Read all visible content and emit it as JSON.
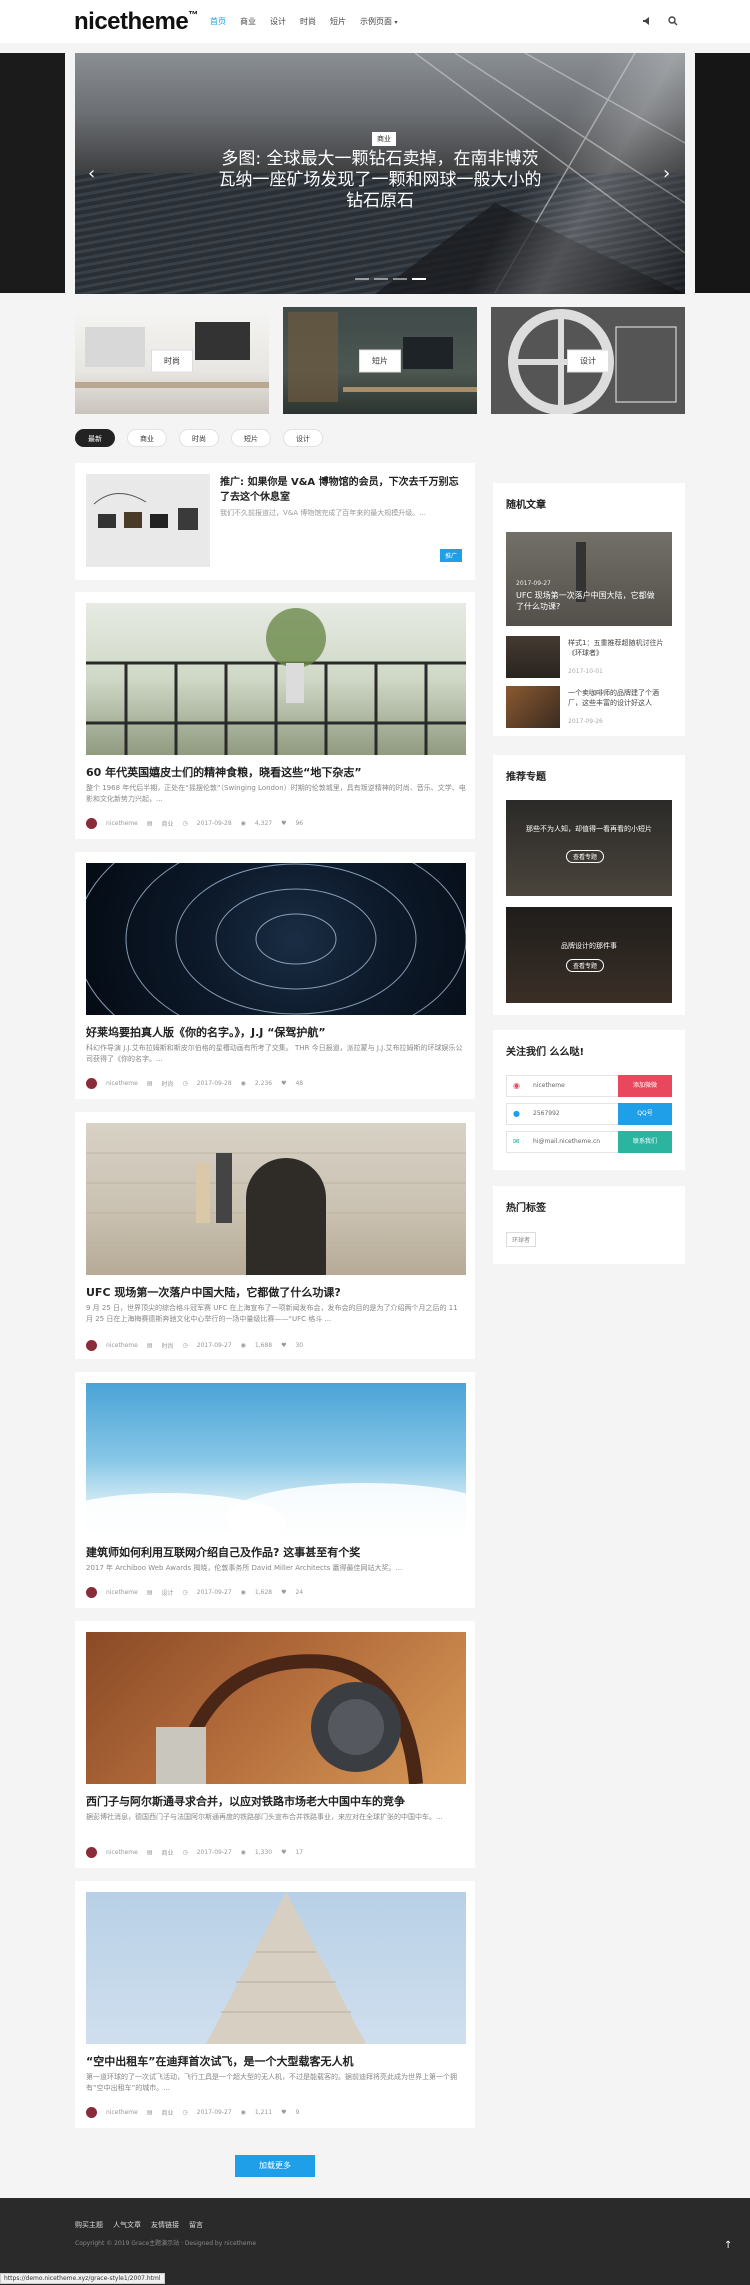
{
  "header": {
    "logo": "nicetheme",
    "logo_tm": "™",
    "nav": [
      "首页",
      "商业",
      "设计",
      "时尚",
      "短片",
      "示例页面"
    ],
    "nav_active": 0
  },
  "hero": {
    "tag": "商业",
    "title": "多图: 全球最大一颗钻石卖掉，在南非博茨瓦纳一座矿场发现了一颗和网球一般大小的钻石原石",
    "prev": "‹",
    "next": "›"
  },
  "categories": [
    "时尚",
    "短片",
    "设计"
  ],
  "tabs": [
    "最新",
    "商业",
    "时尚",
    "短片",
    "设计"
  ],
  "promo": {
    "title": "推广: 如果你是 V&A 博物馆的会员，下次去千万别忘了去这个休息室",
    "excerpt": "我们不久前报道过，V&A 博物馆完成了百年来的最大规模升级。...",
    "badge": "推广"
  },
  "posts": [
    {
      "title": "60 年代英国嬉皮士们的精神食粮，晓看这些“地下杂志”",
      "excerpt": "整个 1968 年代后半期，正处在“摇摆伦敦”（Swinging London）时期的伦敦城里，具有叛逆精神的时尚、音乐、文学、电影和文化新势力兴起，...",
      "author": "nicetheme",
      "cat": "商业",
      "date": "2017-09-28",
      "views": "4,327",
      "likes": "96"
    },
    {
      "title": "好莱坞要拍真人版《你的名字。》，J.J “保驾护航”",
      "excerpt": "科幻作导演 J.J.艾布拉姆斯和斯皮尔伯格的星槽动画有所考了交集。 THR 今日报道，派拉蒙与 J.J.艾布拉姆斯的环球娱乐公司获得了《你的名字。...",
      "author": "nicetheme",
      "cat": "时尚",
      "date": "2017-09-28",
      "views": "2,236",
      "likes": "48"
    },
    {
      "title": "UFC 现场第一次落户中国大陆，它都做了什么功课?",
      "excerpt": "9 月 25 日，世界顶尖的综合格斗冠军赛 UFC 在上海宣布了一项新闻发布会，发布会的目的是为了介绍两个月之后的 11 月 25 日在上海梅赛德斯奔驰文化中心举行的一场中量级比赛——“UFC 格斗 ...",
      "author": "nicetheme",
      "cat": "时尚",
      "date": "2017-09-27",
      "views": "1,688",
      "likes": "30"
    },
    {
      "title": "建筑师如何利用互联网介绍自己及作品? 这事甚至有个奖",
      "excerpt": "2017 年 Archiboo Web Awards 揭晓，伦敦事务所 David Miller Architects 赢得最佳网站大奖。...",
      "author": "nicetheme",
      "cat": "设计",
      "date": "2017-09-27",
      "views": "1,628",
      "likes": "24"
    },
    {
      "title": "西门子与阿尔斯通寻求合并，以应对铁路市场老大中国中车的竞争",
      "excerpt": "据彭博社消息，德国西门子与法国阿尔斯通再度的铁路部门头宣布合并铁路事业，来应对在全球扩张的中国中车。...",
      "author": "nicetheme",
      "cat": "商业",
      "date": "2017-09-27",
      "views": "1,330",
      "likes": "17"
    },
    {
      "title": "“空中出租车”在迪拜首次试飞，是一个大型载客无人机",
      "excerpt": "第一道环球的了一次试飞活动，飞行工具是一个超大型的无人机，不过是能载客的。据前迪拜将亮此成为世界上第一个拥有“空中出租车”的城市。...",
      "author": "nicetheme",
      "cat": "商业",
      "date": "2017-09-27",
      "views": "1,211",
      "likes": "9"
    }
  ],
  "sidebar": {
    "random_title": "随机文章",
    "random_feature": {
      "date": "2017-09-27",
      "title": "UFC 现场第一次落户中国大陆，它都做了什么功课?"
    },
    "random_items": [
      {
        "title": "样式1：五重推荐超随机讨往片《环球者》",
        "date": "2017-10-01"
      },
      {
        "title": "一个卖咖啡师的品牌建了个酒厂，这些丰富的设计好这人",
        "date": "2017-09-26"
      }
    ],
    "topics_title": "推荐专题",
    "topics": [
      {
        "title": "那些不为人知，却值得一看再看的小短片",
        "btn": "查看专题"
      },
      {
        "title": "品牌设计的那件事",
        "btn": "查看专题"
      }
    ],
    "follow_title": "关注我们 么么哒!",
    "follow": [
      {
        "value": "nicetheme",
        "btn": "添加微微",
        "color": "#e8475d"
      },
      {
        "value": "2567992",
        "btn": "QQ号",
        "color": "#1e9fe8"
      },
      {
        "value": "hi@mail.nicetheme.cn",
        "btn": "联系我们",
        "color": "#2bb5a0"
      }
    ],
    "tags_title": "热门标签",
    "tags": [
      "环球者"
    ]
  },
  "load_more": "加载更多",
  "footer": {
    "links": [
      "购买主题",
      "人气文章",
      "友情链接",
      "留言"
    ],
    "copyright": "Copyright © 2019 Grace主题演示站 · Designed by nicetheme",
    "top": "↑"
  },
  "status_url": "https://demo.nicetheme.xyz/grace-style1/2007.html"
}
